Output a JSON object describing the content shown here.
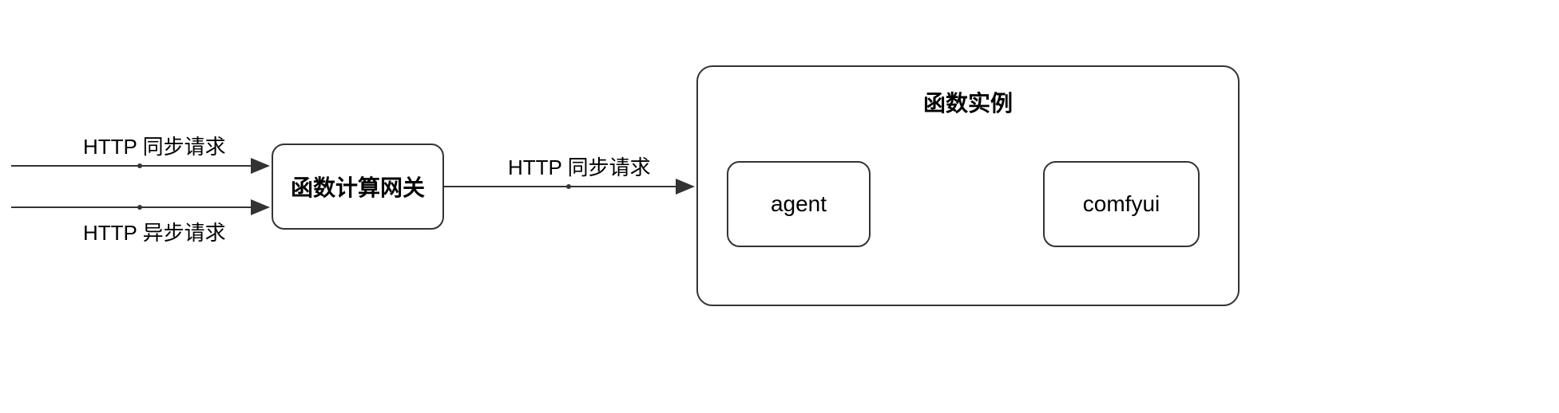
{
  "edges": {
    "http_sync_left": "HTTP 同步请求",
    "http_async_left": "HTTP 异步请求",
    "http_sync_middle": "HTTP 同步请求"
  },
  "nodes": {
    "gateway": "函数计算网关",
    "instance_container": "函数实例",
    "agent": "agent",
    "comfyui": "comfyui"
  }
}
